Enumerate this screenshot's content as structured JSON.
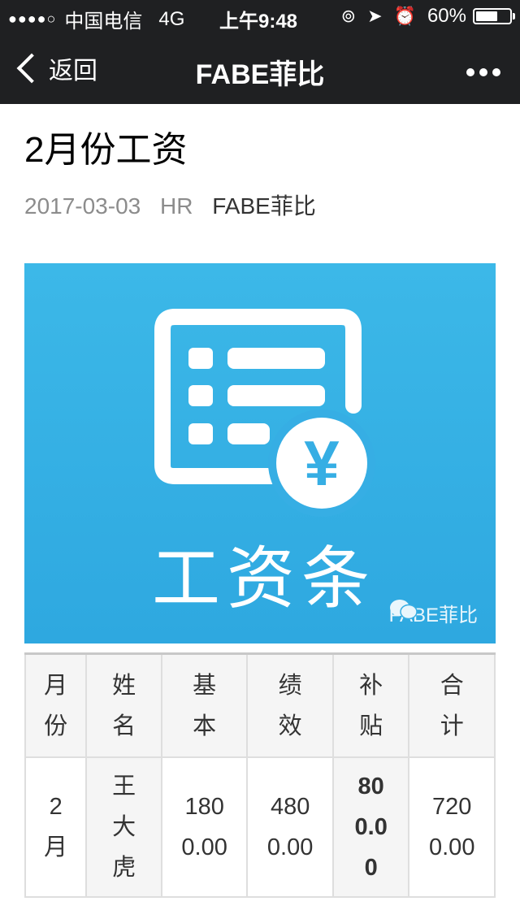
{
  "status_bar": {
    "signal_dots": "●●●●○",
    "carrier": "中国电信",
    "network": "4G",
    "time": "上午9:48",
    "battery": "60%"
  },
  "nav": {
    "back_label": "返回",
    "title": "FABE菲比"
  },
  "article": {
    "title": "2月份工资",
    "date": "2017-03-03",
    "author": "HR",
    "account": "FABE菲比"
  },
  "banner": {
    "caption": "工资条",
    "currency_symbol": "¥",
    "watermark": "FABE菲比"
  },
  "table": {
    "headers": [
      "月份",
      "姓名",
      "基本",
      "绩效",
      "补贴",
      "合计"
    ],
    "rows": [
      [
        "2月",
        "王大虎",
        "1800.00",
        "4800.00",
        "800.00",
        "7200.00"
      ]
    ]
  },
  "colors": {
    "header_bg": "#1f2022",
    "banner_blue": "#36b0e6"
  }
}
